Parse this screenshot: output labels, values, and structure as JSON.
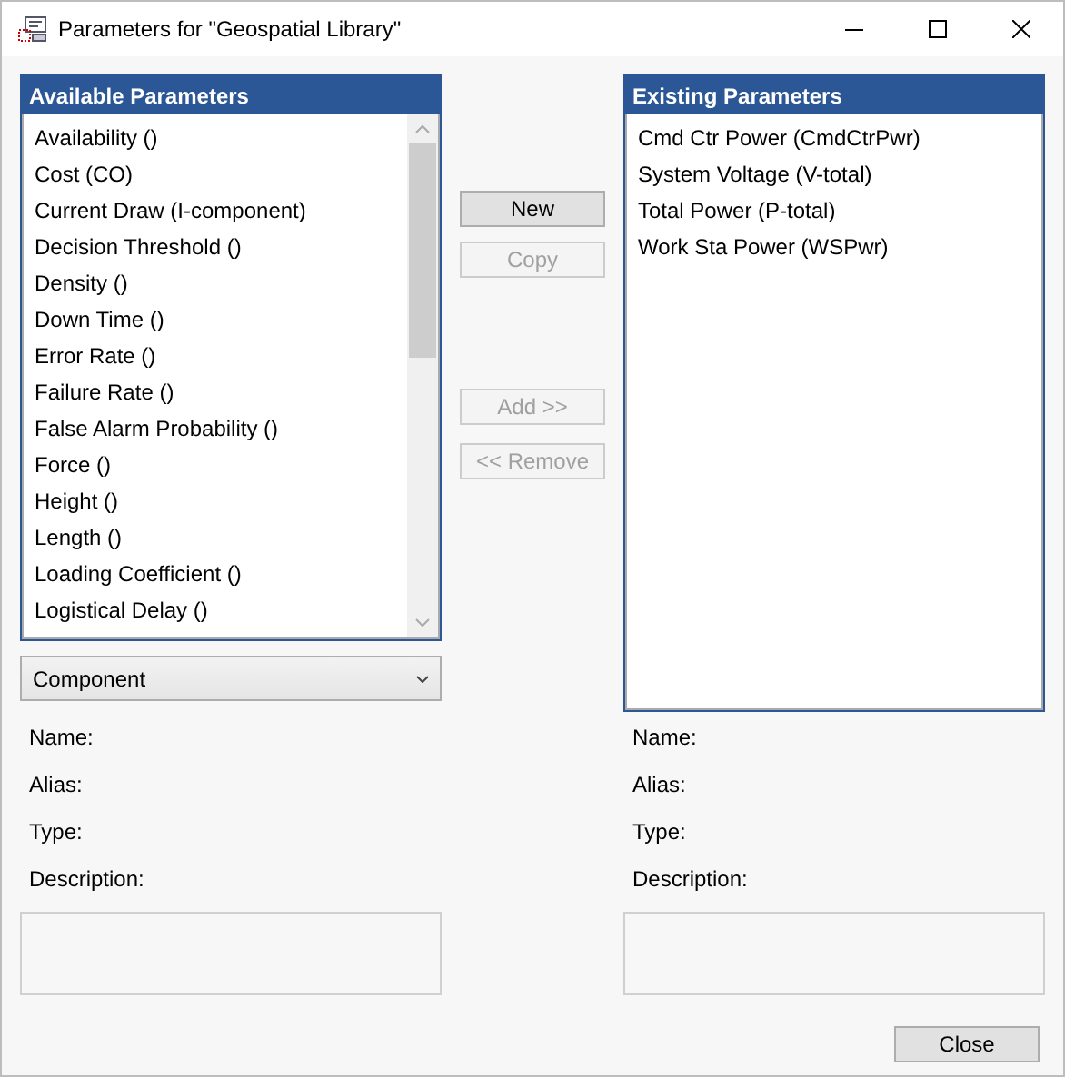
{
  "window": {
    "title": "Parameters for \"Geospatial Library\""
  },
  "available": {
    "header": "Available Parameters",
    "items": [
      {
        "label": "Availability ()",
        "selected": false
      },
      {
        "label": "Cost (CO)",
        "selected": false
      },
      {
        "label": "Current Draw (I-component)",
        "selected": false
      },
      {
        "label": "Decision Threshold ()",
        "selected": false
      },
      {
        "label": "Density ()",
        "selected": false
      },
      {
        "label": "Down Time ()",
        "selected": false
      },
      {
        "label": "Error Rate ()",
        "selected": false
      },
      {
        "label": "Failure Rate ()",
        "selected": false
      },
      {
        "label": "False Alarm Probability ()",
        "selected": false
      },
      {
        "label": "Force ()",
        "selected": false
      },
      {
        "label": "Height ()",
        "selected": false
      },
      {
        "label": "Length ()",
        "selected": false
      },
      {
        "label": "Loading Coefficient ()",
        "selected": false
      },
      {
        "label": "Logistical Delay ()",
        "selected": false
      }
    ],
    "filter": "Component"
  },
  "actions": [
    {
      "label": "New",
      "disabled": false
    },
    {
      "label": "Copy",
      "disabled": true
    },
    {
      "label": "Add >>",
      "disabled": true
    },
    {
      "label": "<< Remove",
      "disabled": true
    }
  ],
  "existing": {
    "header": "Existing Parameters",
    "items": [
      {
        "label": "Cmd Ctr Power (CmdCtrPwr)",
        "selected": false
      },
      {
        "label": "System Voltage (V-total)",
        "selected": false
      },
      {
        "label": "Total Power (P-total)",
        "selected": false
      },
      {
        "label": "Work Sta Power (WSPwr)",
        "selected": false
      }
    ]
  },
  "left_details": {
    "labels": [
      "Name:",
      "Alias:",
      "Type:",
      "Description:"
    ]
  },
  "right_details": {
    "labels": [
      "Name:",
      "Alias:",
      "Type:",
      "Description:"
    ]
  },
  "close_button": "Close"
}
